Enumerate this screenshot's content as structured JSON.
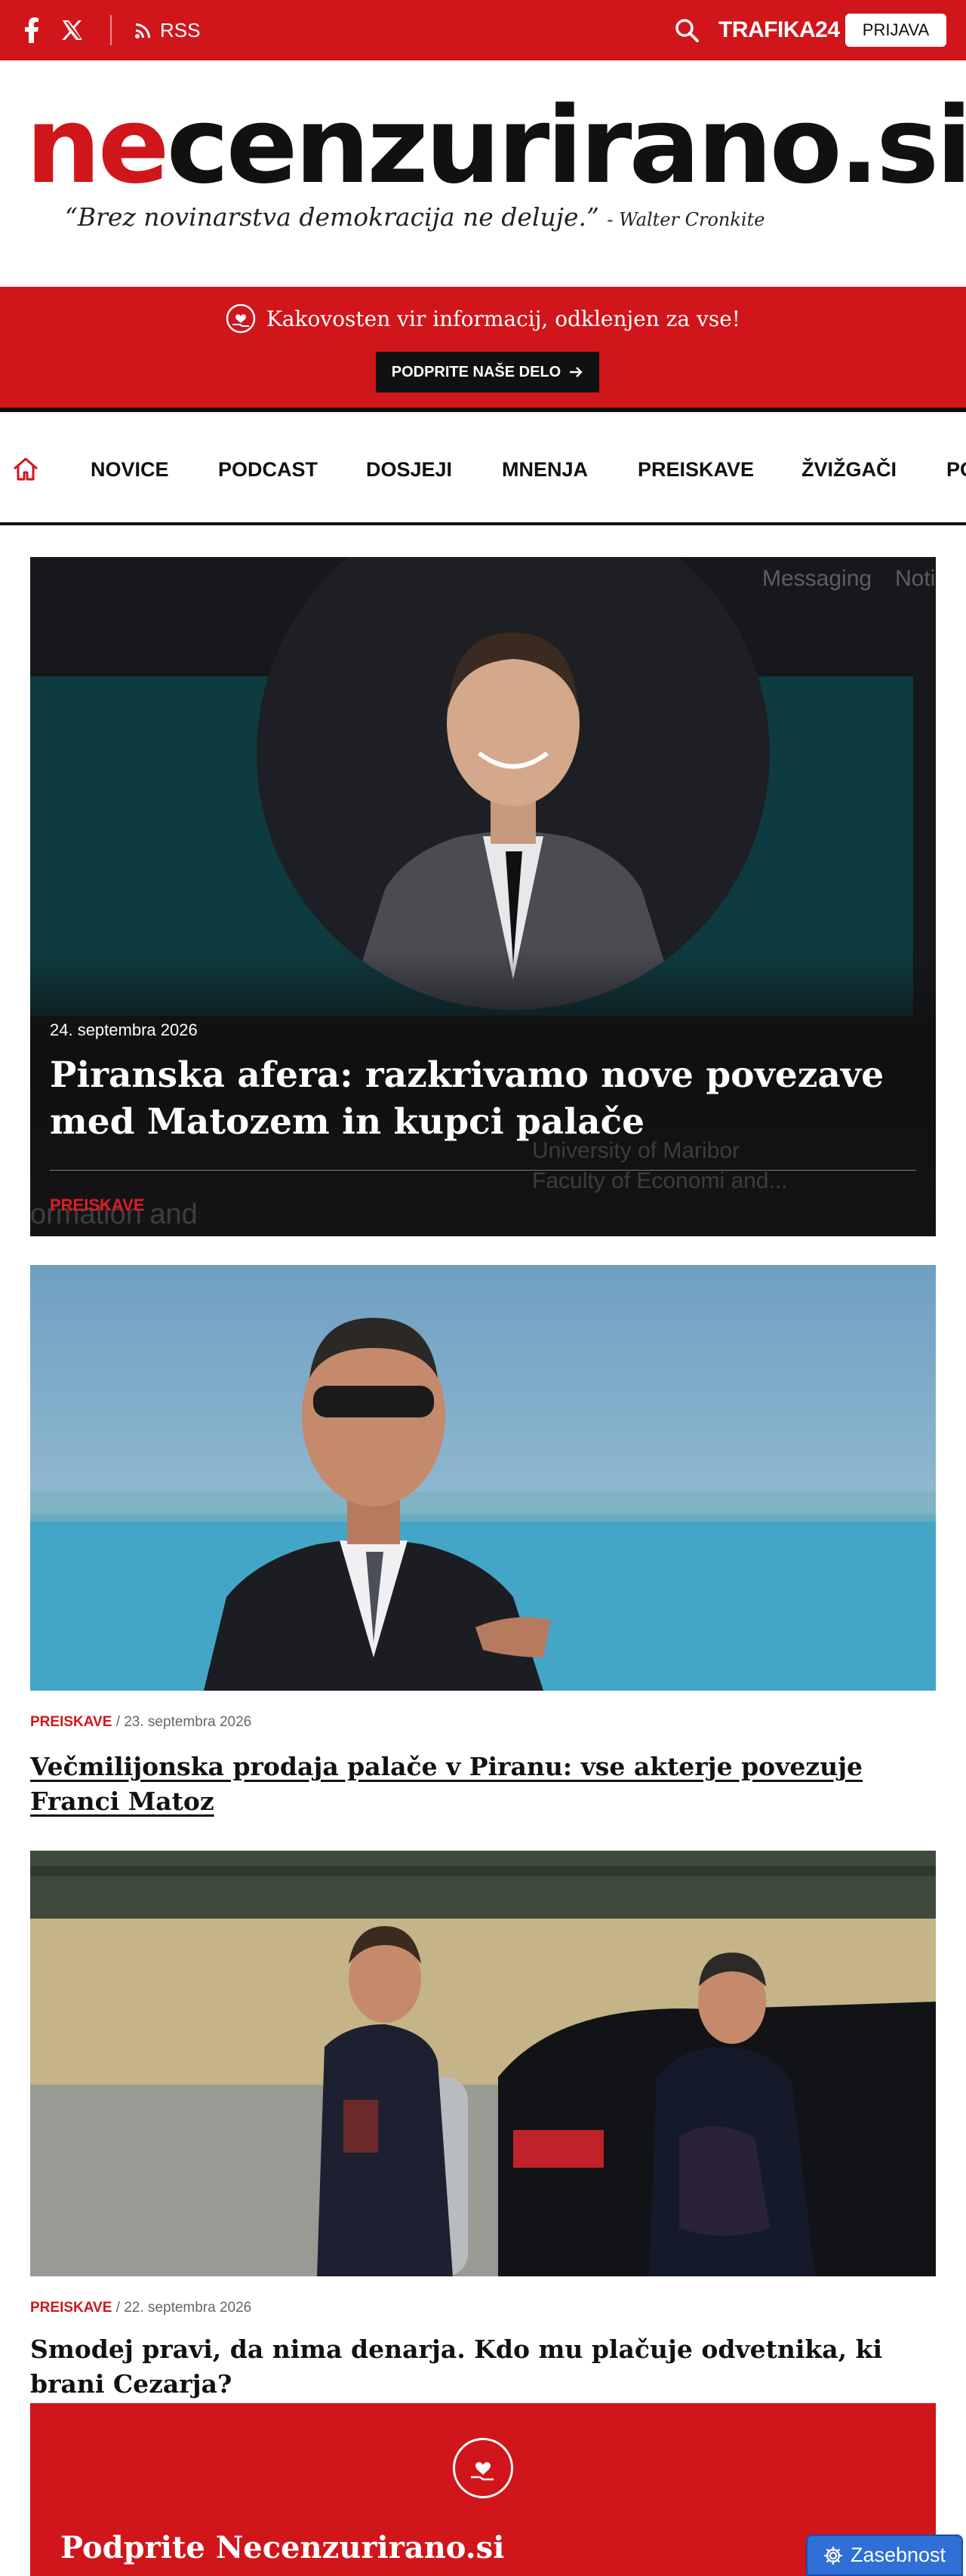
{
  "topbar": {
    "icons": [
      "facebook-icon",
      "x-twitter-icon",
      "rss-icon",
      "search-icon"
    ],
    "rss_label": "RSS",
    "trafika_label": "TRAFIKA24",
    "login_label": "PRIJAVA"
  },
  "masthead": {
    "logo_red": "ne",
    "logo_black": "cenzurirano.si",
    "tagline_quote": "“Brez novinarstva demokracija ne deluje.”",
    "tagline_author": "- Walter Cronkite"
  },
  "banner": {
    "text": "Kakovosten vir informacij, odklenjen za vse!",
    "button_label": "PODPRITE NAŠE DELO"
  },
  "nav": {
    "items": [
      "NOVICE",
      "PODCAST",
      "DOSJEJI",
      "MNENJA",
      "PREISKAVE",
      "ŽVIŽGAČI",
      "PO"
    ]
  },
  "hero": {
    "date": "24. septembra 2026",
    "title": "Piranska afera: razkrivamo nove povezave med Matozem in kupci palače",
    "category": "PREISKAVE",
    "bg_text": {
      "tab1": "Messaging",
      "tab2": "Noti",
      "line1": "University of Maribor",
      "line2": "Faculty of Economi and...",
      "line3": "ormation and"
    }
  },
  "articles": [
    {
      "category": "PREISKAVE",
      "date": "/ 23. septembra 2026",
      "title": "Večmilijonska prodaja palače v Piranu: vse akterje povezuje Franci Matoz"
    },
    {
      "category": "PREISKAVE",
      "date": "/ 22. septembra 2026",
      "title": "Smodej pravi, da nima denarja. Kdo mu plačuje odvetnika, ki brani Cezarja?"
    }
  ],
  "support": {
    "title": "Podprite Necenzurirano.si"
  },
  "privacy": {
    "label": "Zasebnost"
  },
  "colors": {
    "brand_red": "#d0161b",
    "privacy_blue": "#2f6fd6"
  }
}
